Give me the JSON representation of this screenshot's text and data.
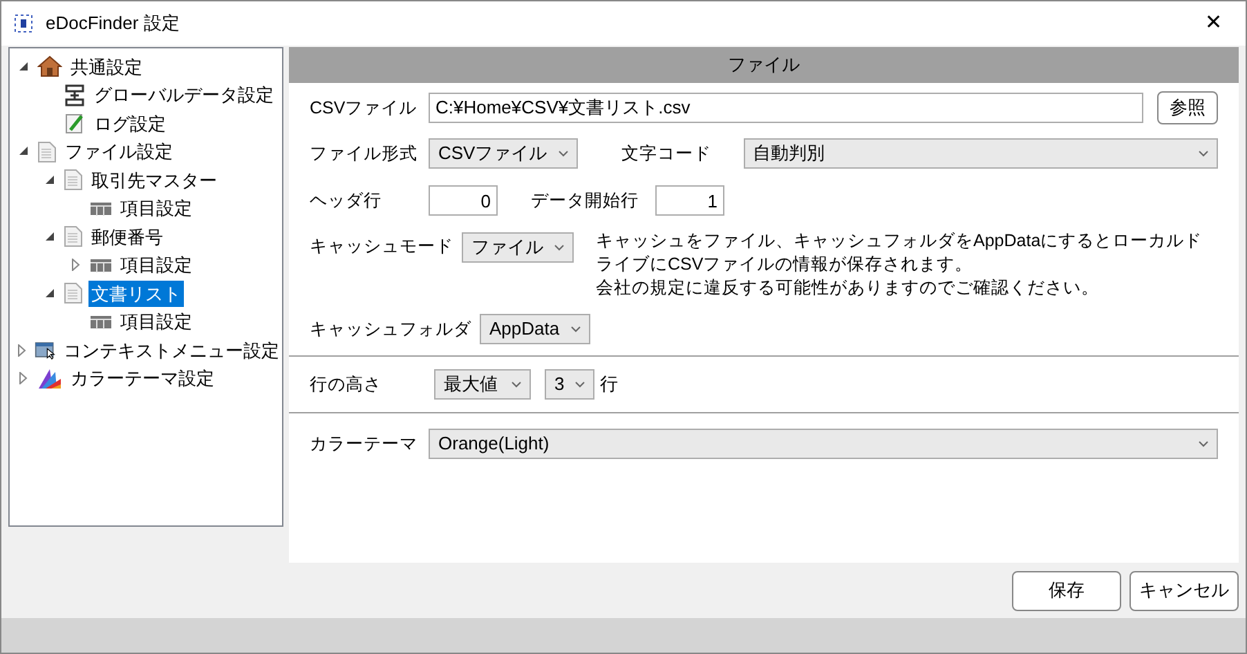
{
  "window": {
    "title": "eDocFinder 設定",
    "close": "✕"
  },
  "tree": [
    {
      "label": "共通設定",
      "kind": "house",
      "expanded": true,
      "selected": false,
      "children": [
        {
          "label": "グローバルデータ設定",
          "kind": "stack",
          "selected": false
        },
        {
          "label": "ログ設定",
          "kind": "pencil",
          "selected": false
        }
      ]
    },
    {
      "label": "ファイル設定",
      "kind": "doc",
      "expanded": true,
      "selected": false,
      "children": [
        {
          "label": "取引先マスター",
          "kind": "doc",
          "expanded": true,
          "selected": false,
          "children": [
            {
              "label": "項目設定",
              "kind": "grid",
              "selected": false
            }
          ]
        },
        {
          "label": "郵便番号",
          "kind": "doc",
          "expanded": true,
          "selected": false,
          "children": [
            {
              "label": "項目設定",
              "kind": "grid",
              "expanded": false,
              "selected": false
            }
          ]
        },
        {
          "label": "文書リスト",
          "kind": "doc",
          "expanded": true,
          "selected": true,
          "children": [
            {
              "label": "項目設定",
              "kind": "grid",
              "selected": false
            }
          ]
        }
      ]
    },
    {
      "label": "コンテキストメニュー設定",
      "kind": "window",
      "expanded": false,
      "selected": false
    },
    {
      "label": "カラーテーマ設定",
      "kind": "palette",
      "expanded": false,
      "selected": false
    }
  ],
  "header": "ファイル",
  "file": {
    "csv_label": "CSVファイル",
    "csv_path": "C:¥Home¥CSV¥文書リスト.csv",
    "browse": "参照",
    "format_label": "ファイル形式",
    "format": "CSVファイル",
    "encoding_label": "文字コード",
    "encoding": "自動判別",
    "header_row_label": "ヘッダ行",
    "header_row": "0",
    "data_start_label": "データ開始行",
    "data_start": "1",
    "cache_mode_label": "キャッシュモード",
    "cache_mode": "ファイル",
    "cache_note": [
      "キャッシュをファイル、キャッシュフォルダをAppDataにするとローカルドライブにCSVファイルの情報が保存されます。",
      "会社の規定に違反する可能性がありますのでご確認ください。"
    ],
    "cache_folder_label": "キャッシュフォルダ",
    "cache_folder": "AppData"
  },
  "row_height": {
    "label": "行の高さ",
    "mode": "最大値",
    "count": "3",
    "unit": "行"
  },
  "theme": {
    "label": "カラーテーマ",
    "value": "Orange(Light)"
  },
  "buttons": [
    "保存",
    "キャンセル"
  ]
}
